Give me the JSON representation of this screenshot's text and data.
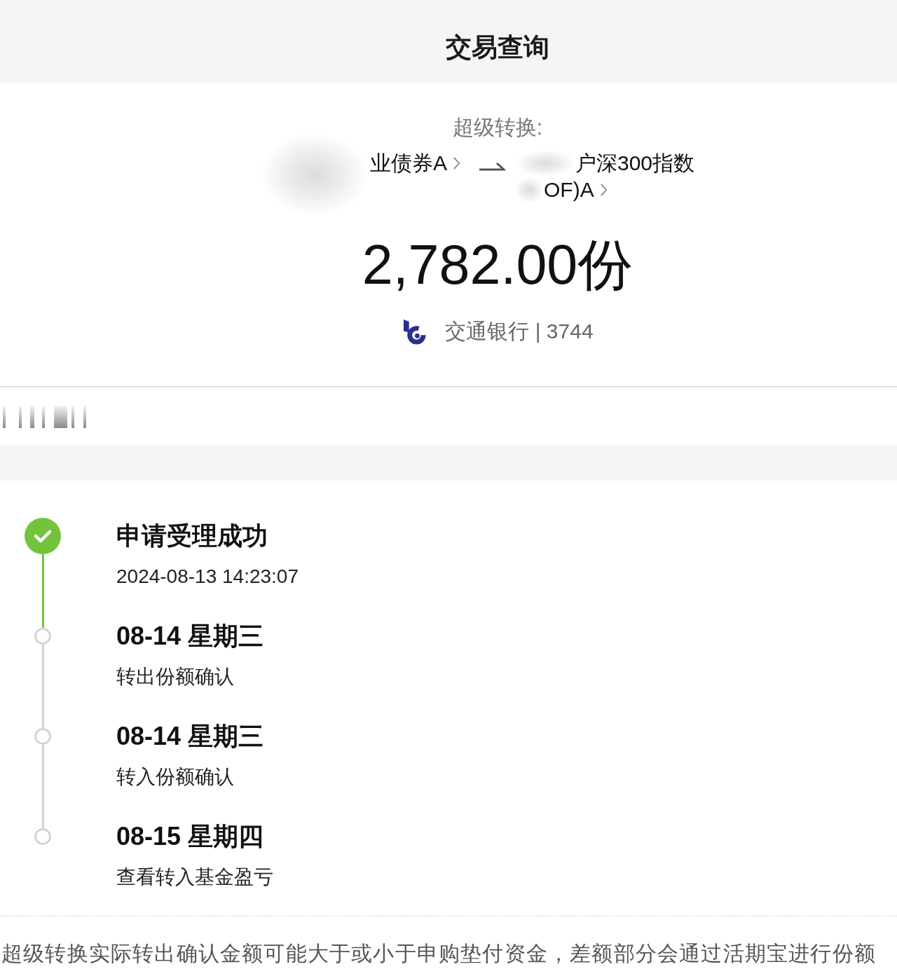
{
  "header": {
    "title": "交易查询"
  },
  "transfer": {
    "label": "超级转换:",
    "fund_out": {
      "lines": [
        "业债券A"
      ]
    },
    "fund_in": {
      "lines": [
        "户深300指数",
        "OF)A"
      ]
    },
    "amount": "2,782.00份",
    "account": "交通银行 | 3744"
  },
  "steps": [
    {
      "heading": "申请受理成功",
      "detail": "2024-08-13 14:23:07",
      "done": true
    },
    {
      "heading": "08-14 星期三",
      "detail": "转出份额确认",
      "done": false
    },
    {
      "heading": "08-14 星期三",
      "detail": "转入份额确认",
      "done": false
    },
    {
      "heading": "08-15 星期四",
      "detail": "查看转入基金盈亏",
      "done": false
    }
  ],
  "footnote": "超级转换实际转出确认金额可能大于或小于申购垫付资金，差额部分会通过活期宝进行份额"
}
